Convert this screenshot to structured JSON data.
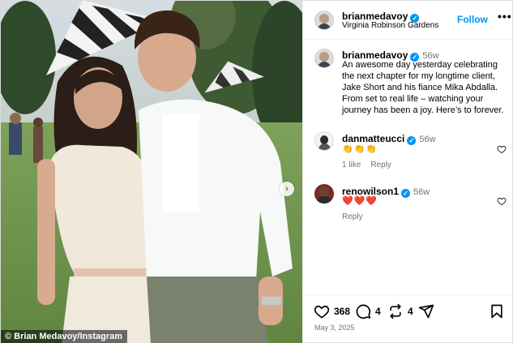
{
  "post": {
    "username": "brianmedavoy",
    "location": "Virginia Robinson Gardens",
    "follow_label": "Follow",
    "more_label": "•••",
    "credit": "© Brian Medavoy/Instagram",
    "caption": {
      "username": "brianmedavoy",
      "age": "56w",
      "text": "An awesome day yesterday celebrating the next chapter for my longtime client, Jake Short and his fiance Mika Abdalla. From set to real life – watching your journey has been a joy. Here’s to forever."
    },
    "comments": [
      {
        "username": "danmatteucci",
        "age": "56w",
        "text": "👏👏👏",
        "likes": "1 like",
        "reply": "Reply"
      },
      {
        "username": "renowilson1",
        "age": "56w",
        "text": "❤️❤️❤️",
        "reply": "Reply"
      }
    ],
    "actions": {
      "likes": "368",
      "comments": "4",
      "reposts": "4"
    },
    "date": "May 3, 2025"
  },
  "icons": [
    "verified-badge-icon",
    "heart-icon",
    "comment-icon",
    "repost-icon",
    "share-icon",
    "bookmark-icon",
    "next-arrow-icon",
    "more-icon"
  ],
  "colors": {
    "accent": "#0095f6",
    "muted": "#737373",
    "border": "#dbdbdb"
  }
}
